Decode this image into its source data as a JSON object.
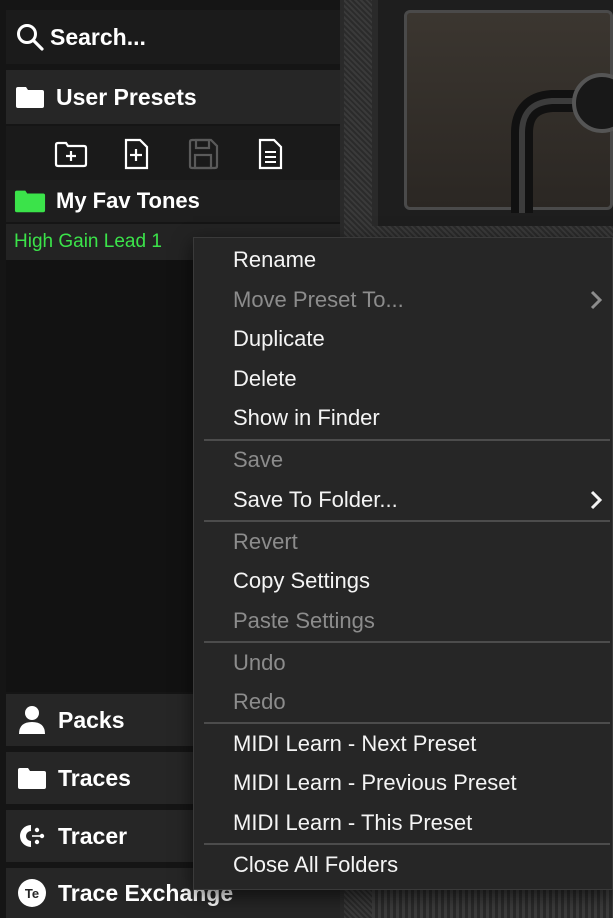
{
  "sidebar": {
    "search_label": "Search...",
    "user_presets_label": "User Presets",
    "folder_label": "My Fav Tones",
    "preset_label": "High Gain Lead 1",
    "nav": {
      "packs": "Packs",
      "traces": "Traces",
      "tracer": "Tracer",
      "trace_exchange": "Trace Exchange",
      "trace_exchange_badge": "Te"
    }
  },
  "toolbar_icons": [
    "new-folder-icon",
    "new-preset-icon",
    "save-icon",
    "document-icon"
  ],
  "menu": {
    "rename": "Rename",
    "move_preset_to": "Move Preset To...",
    "duplicate": "Duplicate",
    "delete": "Delete",
    "show_in_finder": "Show in Finder",
    "save": "Save",
    "save_to_folder": "Save To Folder...",
    "revert": "Revert",
    "copy_settings": "Copy Settings",
    "paste_settings": "Paste Settings",
    "undo": "Undo",
    "redo": "Redo",
    "midi_next": "MIDI Learn - Next Preset",
    "midi_previous": "MIDI Learn - Previous Preset",
    "midi_this": "MIDI Learn - This Preset",
    "close_all_folders": "Close All Folders"
  },
  "colors": {
    "accent_green": "#3be34a",
    "menu_bg": "#262626",
    "disabled_text": "#8c8c8c"
  }
}
